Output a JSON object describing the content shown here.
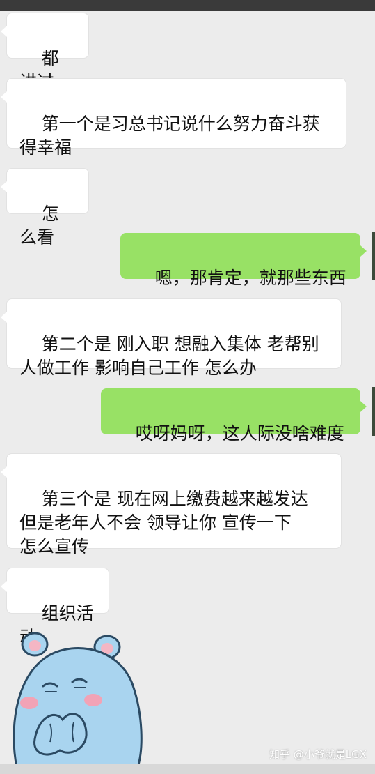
{
  "messages": [
    {
      "side": "left",
      "text": "都讲过"
    },
    {
      "side": "left",
      "text": "第一个是习总书记说什么努力奋斗获\n得幸福"
    },
    {
      "side": "left",
      "text": "怎么看"
    },
    {
      "side": "right",
      "text": "嗯，那肯定，就那些东西"
    },
    {
      "side": "left",
      "text": "第二个是 刚入职 想融入集体 老帮别\n人做工作 影响自己工作 怎么办"
    },
    {
      "side": "right",
      "text": "哎呀妈呀，这人际没啥难度"
    },
    {
      "side": "left",
      "text": "第三个是 现在网上缴费越来越发达\n但是老年人不会 领导让你 宣传一下\n怎么宣传"
    },
    {
      "side": "left",
      "text": "组织活动"
    }
  ],
  "sticker": {
    "icon": "blue-hippo-sticker"
  },
  "watermark": "知乎 @小爷就是LGX",
  "colors": {
    "background": "#ececec",
    "left_bubble": "#ffffff",
    "right_bubble": "#98e165"
  }
}
